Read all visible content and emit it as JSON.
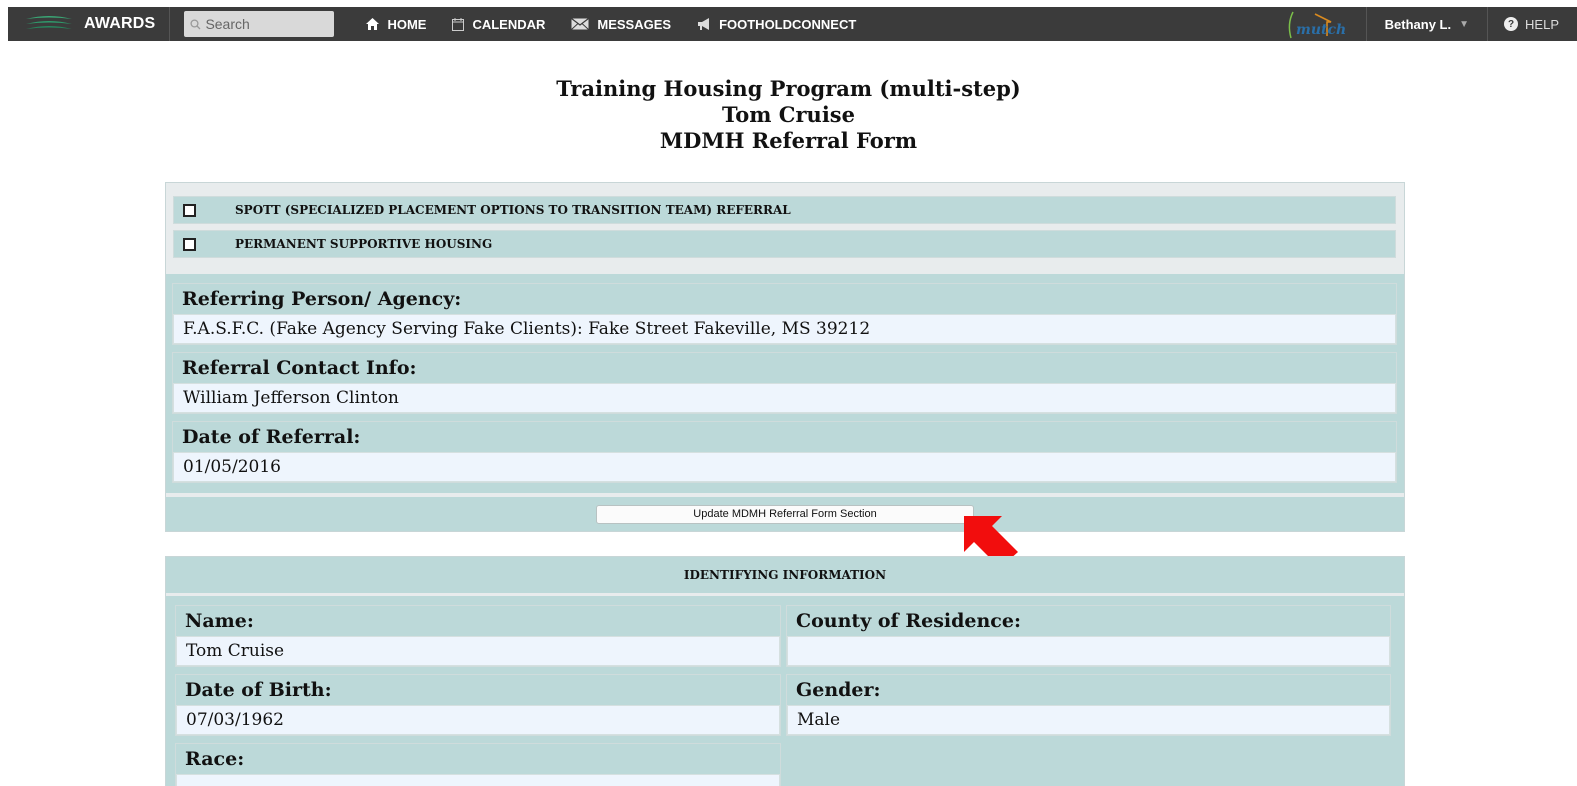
{
  "nav": {
    "brand": "AWARDS",
    "search_placeholder": "Search",
    "links": [
      {
        "label": "HOME",
        "icon": "home-icon"
      },
      {
        "label": "CALENDAR",
        "icon": "calendar-icon"
      },
      {
        "label": "MESSAGES",
        "icon": "envelope-icon"
      },
      {
        "label": "FOOTHOLDCONNECT",
        "icon": "megaphone-icon"
      }
    ],
    "org_logo": "mutch",
    "user": "Bethany L.",
    "help": "HELP"
  },
  "header": {
    "program": "Training Housing Program (multi-step)",
    "client": "Tom Cruise",
    "form": "MDMH Referral Form"
  },
  "referral_types": [
    {
      "label": "SPOTT (SPECIALIZED PLACEMENT OPTIONS TO TRANSITION TEAM) REFERRAL",
      "checked": false
    },
    {
      "label": "PERMANENT SUPPORTIVE HOUSING",
      "checked": false
    }
  ],
  "referral": {
    "agency_label": "Referring Person/ Agency:",
    "agency_value": "F.A.S.F.C. (Fake Agency Serving Fake Clients): Fake Street Fakeville, MS 39212",
    "contact_label": "Referral Contact Info:",
    "contact_value": "William Jefferson Clinton",
    "date_label": "Date of Referral:",
    "date_value": "01/05/2016"
  },
  "update_button": "Update MDMH Referral Form Section",
  "identifying": {
    "heading": "IDENTIFYING INFORMATION",
    "name_label": "Name:",
    "name_value": "Tom Cruise",
    "county_label": "County of Residence:",
    "county_value": "",
    "dob_label": "Date of Birth:",
    "dob_value": "07/03/1962",
    "gender_label": "Gender:",
    "gender_value": "Male",
    "race_label": "Race:"
  },
  "colors": {
    "nav_bg": "#3b3b3b",
    "panel_teal": "#bcd9d9",
    "value_bg": "#eef5fd",
    "arrow": "#f20d0d"
  }
}
